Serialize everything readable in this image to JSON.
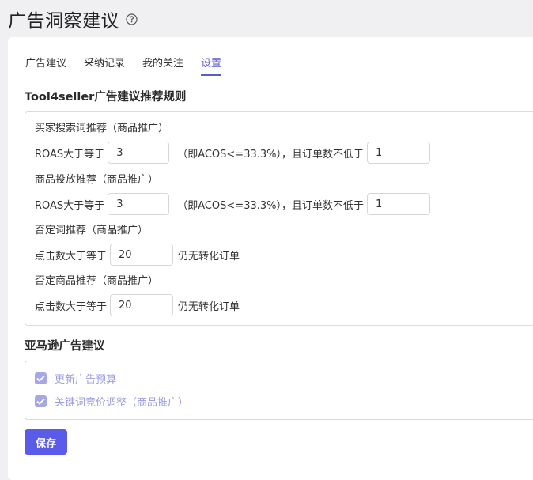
{
  "header": {
    "title": "广告洞察建议"
  },
  "tabs": [
    {
      "label": "广告建议"
    },
    {
      "label": "采纳记录"
    },
    {
      "label": "我的关注"
    },
    {
      "label": "设置"
    }
  ],
  "rules_section": {
    "title": "Tool4seller广告建议推荐规则",
    "rules": [
      {
        "title": "买家搜索词推荐（商品推广）",
        "prefix": "ROAS大于等于",
        "value": "3",
        "middle": "（即ACOS<=33.3%），且订单数不低于",
        "value2": "1"
      },
      {
        "title": "商品投放推荐（商品推广）",
        "prefix": "ROAS大于等于",
        "value": "3",
        "middle": "（即ACOS<=33.3%），且订单数不低于",
        "value2": "1"
      },
      {
        "title": "否定词推荐（商品推广）",
        "prefix": "点击数大于等于",
        "value": "20",
        "suffix": "仍无转化订单"
      },
      {
        "title": "否定商品推荐（商品推广）",
        "prefix": "点击数大于等于",
        "value": "20",
        "suffix": "仍无转化订单"
      }
    ]
  },
  "amazon_section": {
    "title": "亚马逊广告建议",
    "options": [
      {
        "label": "更新广告预算",
        "checked": true
      },
      {
        "label": "关键词竞价调整（商品推广）",
        "checked": true
      }
    ]
  },
  "save_label": "保存",
  "colors": {
    "accent": "#5b5bea",
    "checkbox_disabled": "#a7a7e6",
    "checkbox_label_disabled": "#9c9ce0"
  }
}
